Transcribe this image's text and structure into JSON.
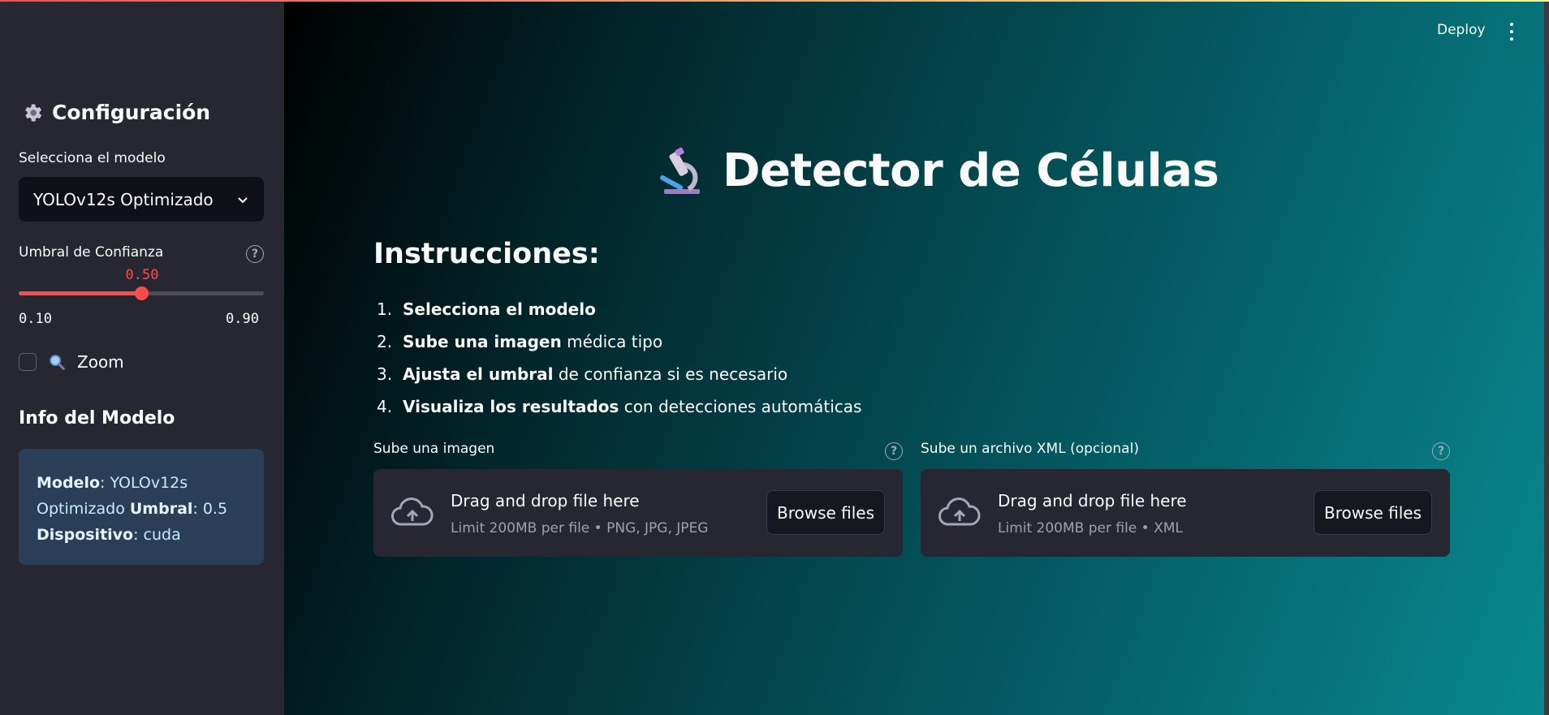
{
  "sidebar": {
    "title": "Configuración",
    "model_label": "Selecciona el modelo",
    "model_selected": "YOLOv12s Optimizado",
    "threshold_label": "Umbral de Confianza",
    "threshold_value": "0.50",
    "threshold_min": "0.10",
    "threshold_max": "0.90",
    "threshold_fraction": 0.5,
    "zoom_label": "Zoom",
    "info_title": "Info del Modelo",
    "info": {
      "model_key": "Modelo",
      "model_val": ": YOLOv12s Optimizado ",
      "threshold_key": "Umbral",
      "threshold_val": ": 0.5",
      "device_key": "Dispositivo",
      "device_val": ": cuda"
    }
  },
  "header": {
    "deploy": "Deploy"
  },
  "main": {
    "title": "Detector de Células",
    "instructions_title": "Instrucciones:",
    "steps": [
      {
        "num": "1.",
        "bold": "Selecciona el modelo",
        "rest": ""
      },
      {
        "num": "2.",
        "bold": "Sube una imagen",
        "rest": " médica tipo"
      },
      {
        "num": "3.",
        "bold": "Ajusta el umbral",
        "rest": " de confianza si es necesario"
      },
      {
        "num": "4.",
        "bold": "Visualiza los resultados",
        "rest": " con detecciones automáticas"
      }
    ],
    "uploaders": [
      {
        "label": "Sube una imagen",
        "title": "Drag and drop file here",
        "sub": "Limit 200MB per file • PNG, JPG, JPEG",
        "button": "Browse files"
      },
      {
        "label": "Sube un archivo XML (opcional)",
        "title": "Drag and drop file here",
        "sub": "Limit 200MB per file • XML",
        "button": "Browse files"
      }
    ]
  },
  "colors": {
    "accent": "#ff4b4b",
    "sidebar_bg": "#262730",
    "info_bg": "#2b3e58"
  },
  "icons": [
    "gear-icon",
    "chevron-down-icon",
    "help-icon",
    "magnifier-icon",
    "microscope-icon",
    "cloud-upload-icon",
    "kebab-menu-icon"
  ]
}
